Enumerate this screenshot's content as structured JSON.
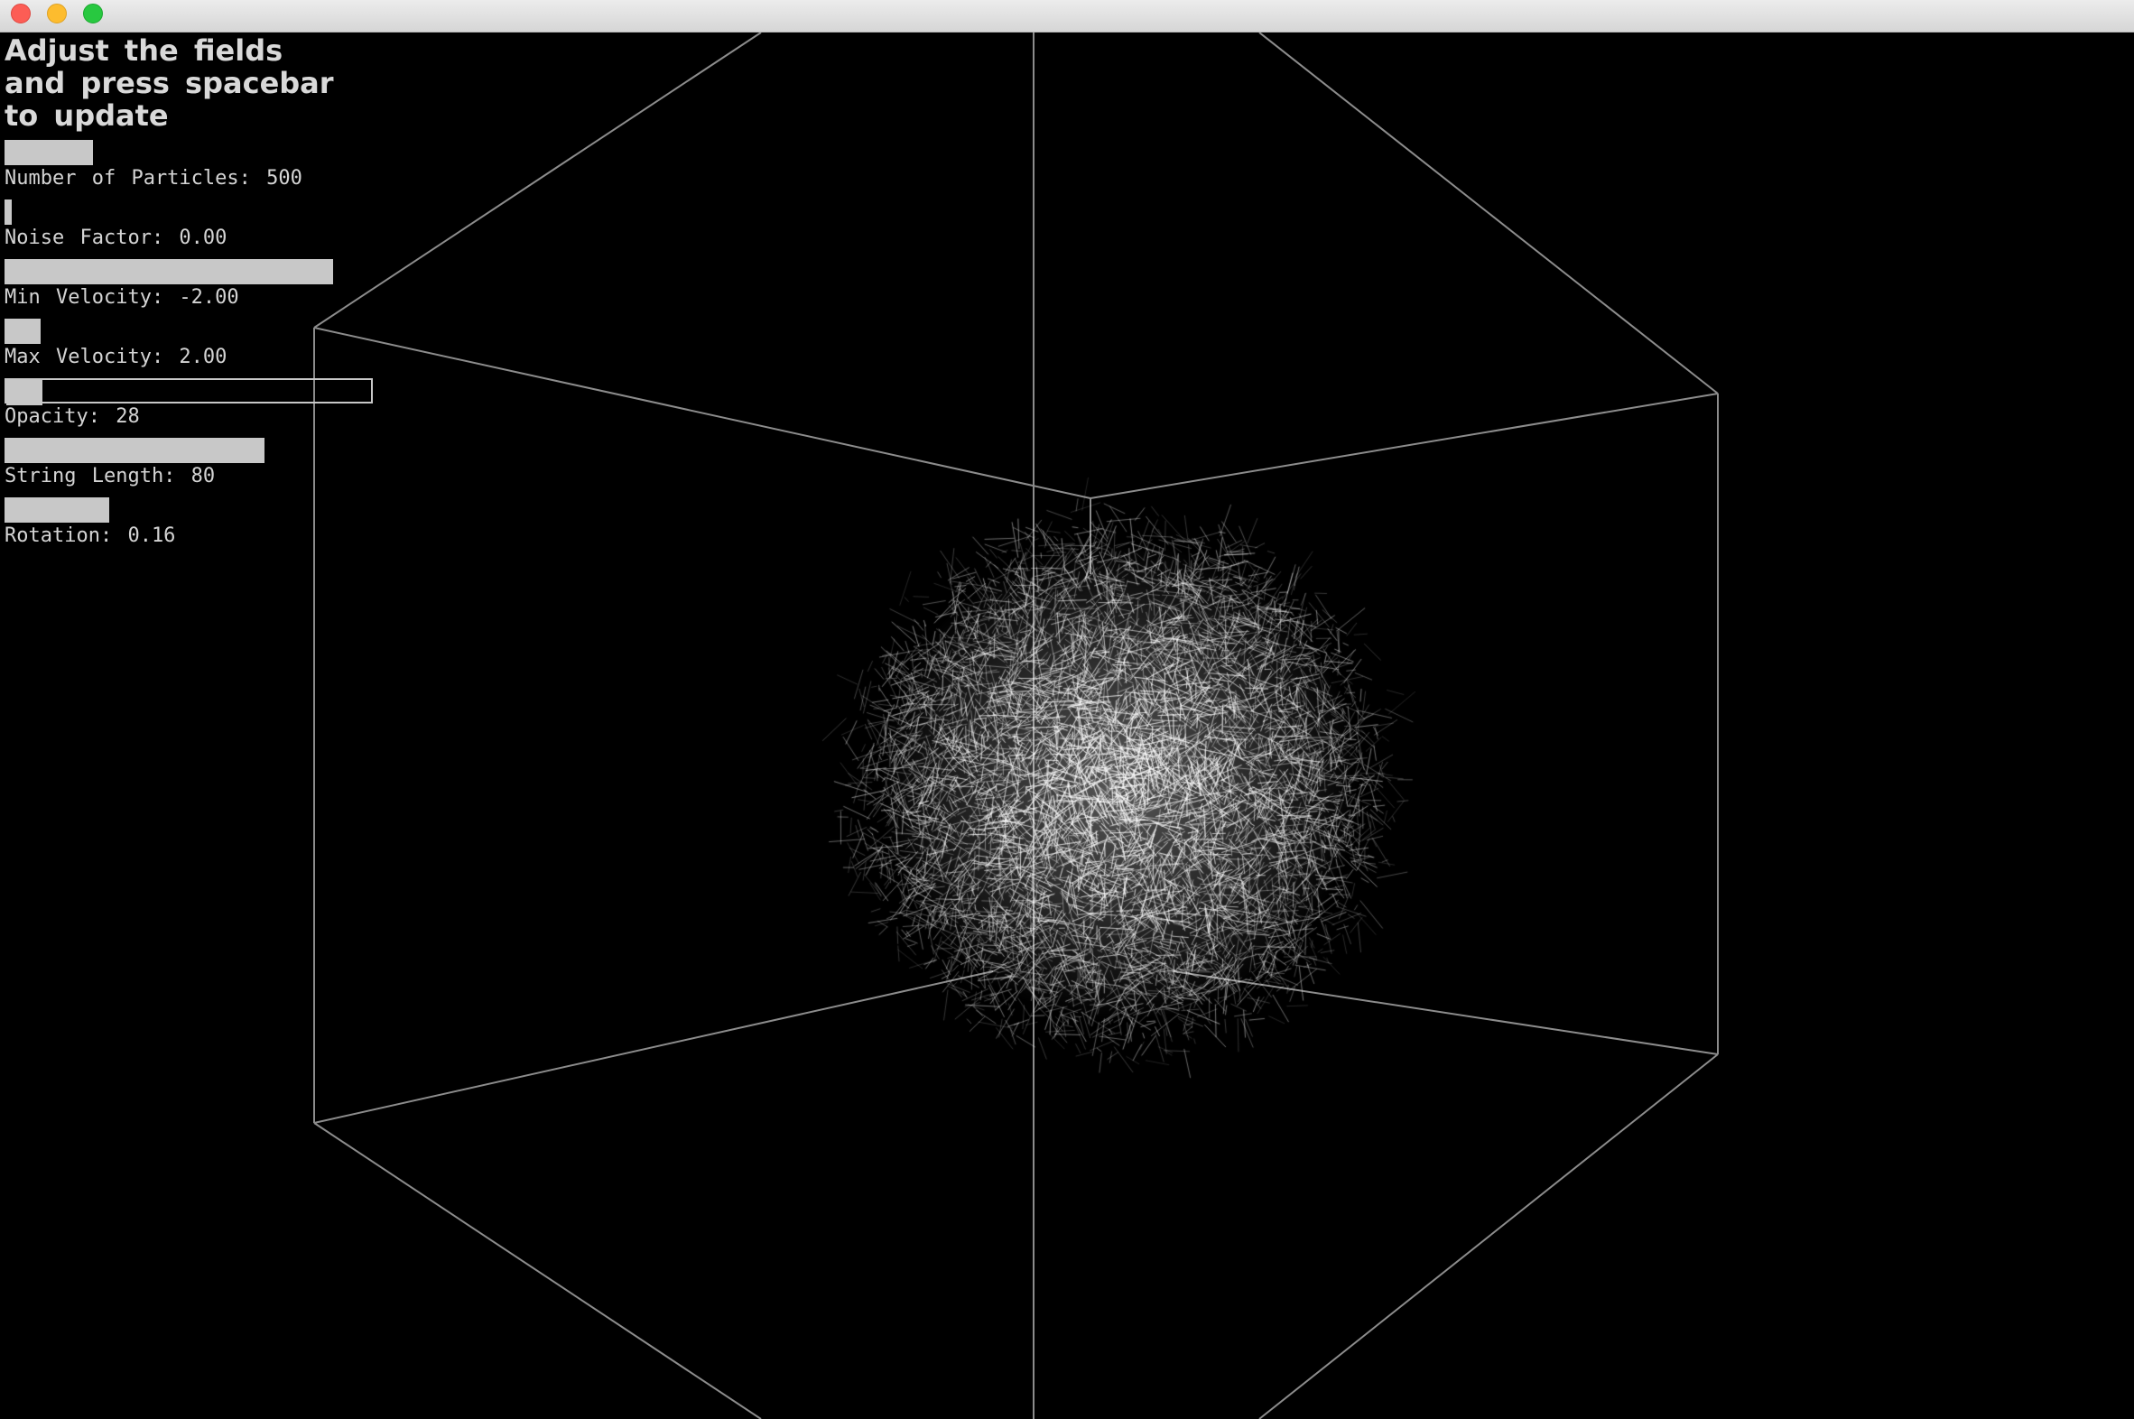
{
  "window": {
    "controls": [
      "close",
      "minimize",
      "maximize"
    ]
  },
  "panel": {
    "instructions": "Adjust the fields\nand press spacebar\nto update",
    "controls": [
      {
        "name": "number-of-particles",
        "label": "Number of Particles: 500",
        "fill_fraction": 0.27,
        "active": false
      },
      {
        "name": "noise-factor",
        "label": "Noise Factor: 0.00",
        "fill_fraction": 0.02,
        "active": false
      },
      {
        "name": "min-velocity",
        "label": "Min Velocity: -2.00",
        "fill_fraction": 1.0,
        "active": false
      },
      {
        "name": "max-velocity",
        "label": "Max Velocity: 2.00",
        "fill_fraction": 0.11,
        "active": false
      },
      {
        "name": "opacity",
        "label": "Opacity: 28",
        "fill_fraction": 0.11,
        "active": true
      },
      {
        "name": "string-length",
        "label": "String Length: 80",
        "fill_fraction": 0.79,
        "active": false
      },
      {
        "name": "rotation",
        "label": "Rotation: 0.16",
        "fill_fraction": 0.32,
        "active": false
      }
    ]
  },
  "colors": {
    "background": "#000000",
    "wireframe": "#8c8c8c",
    "particles": "#ffffff",
    "slider": "#c8c8c8",
    "text": "#d8d8d8"
  }
}
